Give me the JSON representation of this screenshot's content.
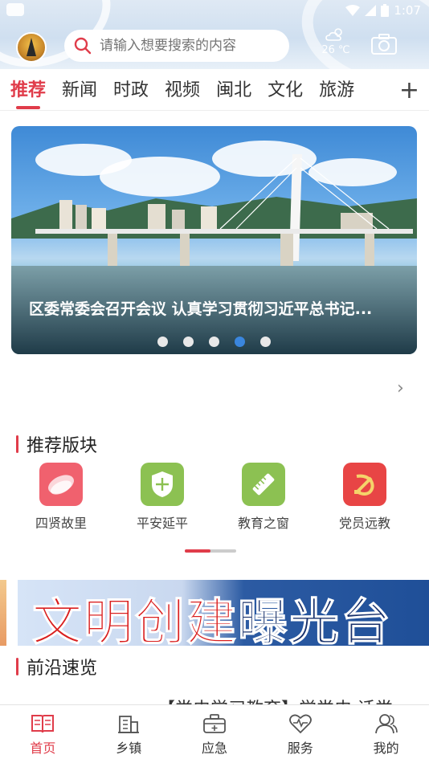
{
  "status_bar": {
    "time": "1:07"
  },
  "header": {
    "search_placeholder": "请输入想要搜索的内容",
    "weather_temp": "26 ℃"
  },
  "tabs": [
    {
      "label": "推荐",
      "active": true
    },
    {
      "label": "新闻",
      "active": false
    },
    {
      "label": "时政",
      "active": false
    },
    {
      "label": "视频",
      "active": false
    },
    {
      "label": "闽北",
      "active": false
    },
    {
      "label": "文化",
      "active": false
    },
    {
      "label": "旅游",
      "active": false
    }
  ],
  "tab_add": "+",
  "banner": {
    "title": "区委常委会召开会议 认真学习贯彻习近平总书记...",
    "slide_count": 5,
    "active_slide": 4
  },
  "recommend_section": {
    "title": "推荐版块",
    "items": [
      {
        "label": "四贤故里",
        "icon": "stone-icon",
        "color": "#f0616e"
      },
      {
        "label": "平安延平",
        "icon": "shield-icon",
        "color": "#8cc152"
      },
      {
        "label": "教育之窗",
        "icon": "ruler-icon",
        "color": "#8cc152"
      },
      {
        "label": "党员远教",
        "icon": "party-emblem-icon",
        "color": "#e84545"
      }
    ]
  },
  "civilization_banner": {
    "text_red": "文明创建",
    "text_blue": "曝光台"
  },
  "frontline_section": {
    "title": "前沿速览",
    "peek_text": "【党史学习教育】学党史 话党"
  },
  "bottom_nav": [
    {
      "label": "首页",
      "icon": "book-icon",
      "active": true
    },
    {
      "label": "乡镇",
      "icon": "building-icon",
      "active": false
    },
    {
      "label": "应急",
      "icon": "first-aid-kit-icon",
      "active": false
    },
    {
      "label": "服务",
      "icon": "heart-icon",
      "active": false
    },
    {
      "label": "我的",
      "icon": "user-icon",
      "active": false
    }
  ],
  "colors": {
    "accent": "#e03c4a",
    "dot_active": "#3a86de"
  }
}
